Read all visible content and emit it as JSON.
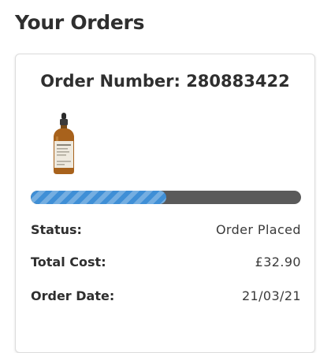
{
  "page": {
    "title": "Your Orders"
  },
  "order": {
    "number_label": "Order Number: 280883422",
    "product_icon": "serum-bottle-image",
    "progress_fraction": 0.5,
    "progress_color": "#3f8fd6",
    "details": [
      {
        "label": "Status:",
        "value": "Order Placed"
      },
      {
        "label": "Total Cost:",
        "value": "£32.90"
      },
      {
        "label": "Order Date:",
        "value": "21/03/21"
      }
    ]
  }
}
